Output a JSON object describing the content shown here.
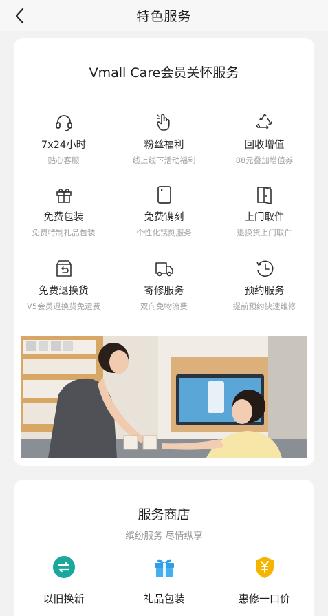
{
  "header": {
    "title": "特色服务",
    "back_icon": "chevron-left-icon"
  },
  "care": {
    "title": "Vmall Care会员关怀服务",
    "services": [
      {
        "title": "7x24小时",
        "subtitle": "贴心客服",
        "icon": "headset-icon"
      },
      {
        "title": "粉丝福利",
        "subtitle": "线上线下活动福利",
        "icon": "hand-gesture-icon"
      },
      {
        "title": "回收增值",
        "subtitle": "88元叠加增值券",
        "icon": "recycle-icon"
      },
      {
        "title": "免费包装",
        "subtitle": "免费特制礼品包装",
        "icon": "gift-icon"
      },
      {
        "title": "免费镌刻",
        "subtitle": "个性化镌刻服务",
        "icon": "engrave-card-icon"
      },
      {
        "title": "上门取件",
        "subtitle": "退换货上门取件",
        "icon": "door-icon"
      },
      {
        "title": "免费退换货",
        "subtitle": "V5会员退换货免运费",
        "icon": "return-box-icon"
      },
      {
        "title": "寄修服务",
        "subtitle": "双向免物流费",
        "icon": "delivery-truck-icon"
      },
      {
        "title": "预约服务",
        "subtitle": "提前预约快速维修",
        "icon": "clock-history-icon"
      }
    ],
    "photo_description": "store-staff-serving-customer-photo"
  },
  "store": {
    "title": "服务商店",
    "subtitle": "缤纷服务 尽情纵享",
    "items": [
      {
        "label": "以旧换新",
        "icon": "trade-in-icon",
        "color": "#1aa89c"
      },
      {
        "label": "礼品包装",
        "icon": "gift-box-icon",
        "color": "#2f9ee8"
      },
      {
        "label": "惠修一口价",
        "icon": "shield-yuan-icon",
        "color": "#f5b400"
      }
    ]
  }
}
